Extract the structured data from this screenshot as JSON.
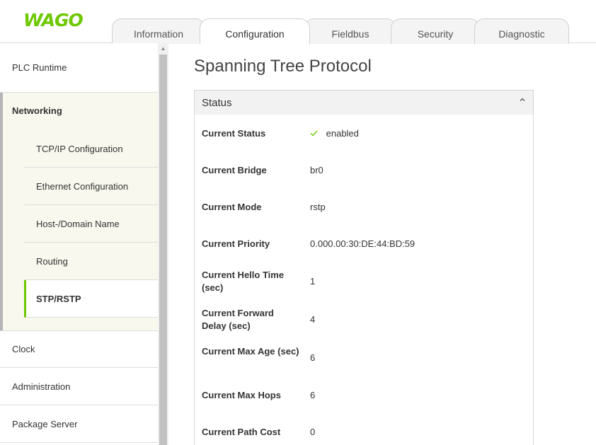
{
  "brand": {
    "logo_text": "WAGO",
    "accent_color": "#6ec800"
  },
  "tabs": [
    {
      "label": "Information"
    },
    {
      "label": "Configuration"
    },
    {
      "label": "Fieldbus"
    },
    {
      "label": "Security"
    },
    {
      "label": "Diagnostic"
    }
  ],
  "sidebar": {
    "items_top": [
      {
        "label": "PLC Runtime"
      }
    ],
    "group": {
      "label": "Networking",
      "children": [
        {
          "label": "TCP/IP Configuration"
        },
        {
          "label": "Ethernet Configuration"
        },
        {
          "label": "Host-/Domain Name"
        },
        {
          "label": "Routing"
        },
        {
          "label": "STP/RSTP"
        }
      ]
    },
    "items_bottom": [
      {
        "label": "Clock"
      },
      {
        "label": "Administration"
      },
      {
        "label": "Package Server"
      }
    ]
  },
  "main": {
    "title": "Spanning Tree Protocol",
    "panel": {
      "title": "Status",
      "rows": [
        {
          "label": "Current Status",
          "value": "enabled",
          "icon": "check-icon"
        },
        {
          "label": "Current Bridge",
          "value": "br0"
        },
        {
          "label": "Current Mode",
          "value": "rstp"
        },
        {
          "label": "Current Priority",
          "value": "0.000.00:30:DE:44:BD:59"
        },
        {
          "label": "Current Hello Time (sec)",
          "value": "1"
        },
        {
          "label": "Current Forward Delay (sec)",
          "value": "4"
        },
        {
          "label": "Current Max Age (sec)",
          "value": "6"
        },
        {
          "label": "Current Max Hops",
          "value": "6"
        },
        {
          "label": "Current Path Cost",
          "value": "0"
        }
      ]
    }
  }
}
